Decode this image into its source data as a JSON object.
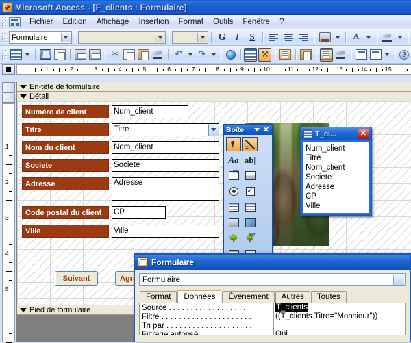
{
  "window": {
    "title": "Microsoft Access - [F_clients : Formulaire]",
    "app_icon": "access-key-icon"
  },
  "menubar": {
    "control_icon": "window-control-icon",
    "items": [
      {
        "label": "Fichier"
      },
      {
        "label": "Edition"
      },
      {
        "label": "Affichage"
      },
      {
        "label": "Insertion"
      },
      {
        "label": "Format"
      },
      {
        "label": "Outils"
      },
      {
        "label": "Fenêtre"
      },
      {
        "label": "?"
      }
    ]
  },
  "formatting_toolbar": {
    "object_combo": {
      "value": "Formulaire"
    },
    "font_combo": {
      "value": ""
    },
    "size_combo": {
      "value": ""
    },
    "bold": "G",
    "italic": "I",
    "underline": "S",
    "align_left": "align-left-icon",
    "align_center": "align-center-icon",
    "align_right": "align-right-icon",
    "fill_color": "fill-color-icon",
    "font_color": "A",
    "line_color": "line-color-icon"
  },
  "standard_toolbar": {
    "view_label": "view-icon",
    "buttons": [
      "save-icon",
      "search-icon",
      "print-icon",
      "print-preview-icon",
      "cut-icon",
      "copy-icon",
      "paste-icon",
      "format-painter-icon",
      "undo-icon",
      "redo-icon",
      "hyperlink-icon",
      "field-list-icon",
      "toolbox-icon",
      "autoformat-icon",
      "code-icon",
      "properties-icon",
      "build-icon",
      "database-window-icon",
      "new-object-icon",
      "help-icon"
    ]
  },
  "rulers": {
    "horizontal_ticks": [
      "1",
      "2",
      "3",
      "4",
      "5",
      "6",
      "7",
      "8",
      "9",
      "10",
      "11",
      "12",
      "13",
      "14",
      "15"
    ],
    "vertical_ticks": [
      "1",
      "2",
      "3",
      "4",
      "5"
    ]
  },
  "form_design": {
    "bands": [
      {
        "name": "En-tête de formulaire"
      },
      {
        "name": "Détail"
      },
      {
        "name": "Pied de formulaire"
      }
    ],
    "controls": [
      {
        "label": "Numéro de client",
        "value": "Num_client",
        "type": "textbox"
      },
      {
        "label": "Titre",
        "value": "Titre",
        "type": "combobox"
      },
      {
        "label": "Nom du client",
        "value": "Nom_client",
        "type": "textbox"
      },
      {
        "label": "Societe",
        "value": "Societe",
        "type": "textbox"
      },
      {
        "label": "Adresse",
        "value": "Adresse",
        "type": "textbox"
      },
      {
        "label": "Code postal du client",
        "value": "CP",
        "type": "textbox"
      },
      {
        "label": "Ville",
        "value": "Ville",
        "type": "textbox"
      }
    ],
    "buttons": [
      {
        "label": "Suivant"
      },
      {
        "label": "Agrandir"
      }
    ],
    "label_color": "#9c3a11",
    "label_text_color": "#ffffff"
  },
  "toolbox": {
    "title": "Boîte",
    "dropdown_icon": "chevron-down-icon",
    "close_icon": "close-icon",
    "tools": [
      {
        "name": "select-objects-tool",
        "selected": true
      },
      {
        "name": "control-wizards-tool",
        "selected": true
      },
      {
        "name": "label-tool",
        "glyph": "Aa"
      },
      {
        "name": "textbox-tool",
        "glyph": "ab|"
      },
      {
        "name": "option-group-tool",
        "glyph": "XYZ"
      },
      {
        "name": "toggle-button-tool"
      },
      {
        "name": "option-button-tool"
      },
      {
        "name": "check-box-tool"
      },
      {
        "name": "combo-box-tool"
      },
      {
        "name": "list-box-tool"
      },
      {
        "name": "command-button-tool"
      },
      {
        "name": "image-tool"
      },
      {
        "name": "unbound-object-frame-tool"
      },
      {
        "name": "bound-object-frame-tool"
      },
      {
        "name": "page-break-tool"
      },
      {
        "name": "tab-control-tool"
      },
      {
        "name": "subform-subreport-tool"
      },
      {
        "name": "line-tool"
      },
      {
        "name": "rectangle-tool"
      },
      {
        "name": "more-controls-tool"
      }
    ]
  },
  "field_list": {
    "title": "T_cl...",
    "icon": "table-icon",
    "close_icon": "close-icon",
    "fields": [
      "Num_client",
      "Titre",
      "Nom_client",
      "Societe",
      "Adresse",
      "CP",
      "Ville"
    ]
  },
  "properties_dialog": {
    "title": "Formulaire",
    "icon": "properties-icon",
    "selector": {
      "value": "Formulaire"
    },
    "tabs": [
      {
        "label": "Format",
        "active": false
      },
      {
        "label": "Données",
        "active": true
      },
      {
        "label": "Événement",
        "active": false
      },
      {
        "label": "Autres",
        "active": false
      },
      {
        "label": "Toutes",
        "active": false
      }
    ],
    "rows": [
      {
        "name": "Source",
        "dots": " . . . . . . . . . . . . . . . . . .",
        "value": "T_clients",
        "selected": true
      },
      {
        "name": "Filtre",
        "dots": " . . . . . . . . . . . . . . . . . . . . .",
        "value": "((T_clients.Titre=\"Monsieur\"))",
        "selected": false
      },
      {
        "name": "Tri par",
        "dots": " . . . . . . . . . . . . . . . . . . . .",
        "value": "",
        "selected": false
      },
      {
        "name": "Filtrage autorisé",
        "dots": " . . . . . . . . . . . . . .",
        "value": "Oui",
        "selected": false
      }
    ]
  },
  "colors": {
    "titlebar": "#1957c8",
    "label_brown": "#9c3a11",
    "toolbox_blue": "#0f50bc",
    "tab_accent": "#f0a830",
    "dialog_face": "#ece9d8"
  }
}
